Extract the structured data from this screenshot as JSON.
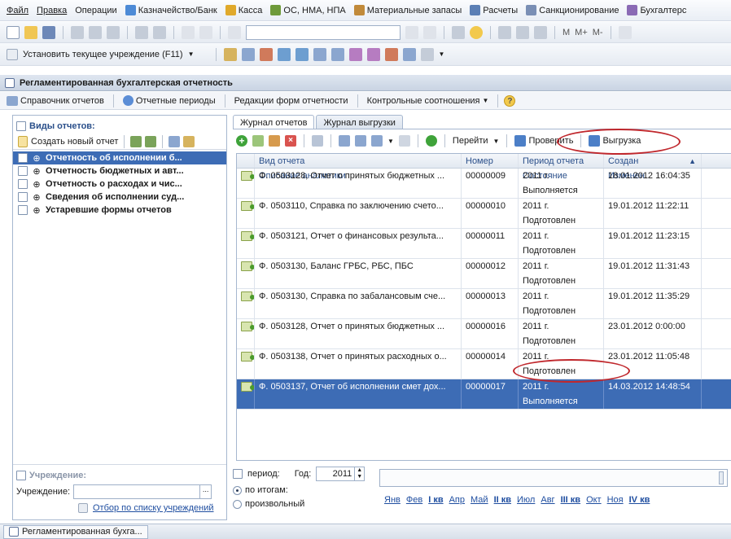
{
  "menubar": {
    "items": [
      {
        "label": "Файл",
        "icon": "none"
      },
      {
        "label": "Правка",
        "icon": "none"
      },
      {
        "label": "Операции",
        "icon": "none"
      },
      {
        "label": "Казначейство/Банк",
        "icon": "treasury-icon"
      },
      {
        "label": "Касса",
        "icon": "cashbox-icon"
      },
      {
        "label": "ОС, НМА, НПА",
        "icon": "assets-icon"
      },
      {
        "label": "Материальные запасы",
        "icon": "inventory-icon"
      },
      {
        "label": "Расчеты",
        "icon": "settlements-icon"
      },
      {
        "label": "Санкционирование",
        "icon": "authorization-icon"
      },
      {
        "label": "Бухгалтерс",
        "icon": "accounting-icon"
      }
    ]
  },
  "toolbar2": {
    "memory_buttons": [
      "M",
      "M+",
      "M-"
    ]
  },
  "toolbar3": {
    "set_institution_label": "Установить текущее учреждение (F11)"
  },
  "window": {
    "title": "Регламентированная бухгалтерская отчетность"
  },
  "cmdbar": {
    "items": [
      "Справочник отчетов",
      "Отчетные периоды",
      "Редакции форм отчетности",
      "Контрольные соотношения"
    ]
  },
  "left": {
    "group_label": "Виды отчетов:",
    "create_label": "Создать новый отчет",
    "tree": [
      "Отчетность об исполнении б...",
      "Отчетность бюджетных и авт...",
      "Отчетность о расходах и чис...",
      "Сведения об исполнении суд...",
      "Устаревшие формы отчетов"
    ],
    "institution_group": "Учреждение:",
    "institution_label": "Учреждение:",
    "institution_value": "",
    "filter_link": "Отбор по списку учреждений"
  },
  "tabs": [
    "Журнал отчетов",
    "Журнал выгрузки"
  ],
  "grid_toolbar": {
    "goto": "Перейти",
    "check": "Проверить",
    "export": "Выгрузка"
  },
  "grid": {
    "headers_top": [
      "Вид отчета",
      "Номер",
      "Период отчета",
      "Создан"
    ],
    "headers_bottom": [
      "Описание аналитики",
      "",
      "Состояние",
      "Изменен"
    ],
    "rows": [
      {
        "type": "Ф. 0503128, Отчет о принятых бюджетных ...",
        "number": "00000009",
        "period": "2011 г.",
        "state": "Выполняется",
        "created": "18.01.2012 16:04:35",
        "changed": ""
      },
      {
        "type": "Ф. 0503110, Справка по заключению счето...",
        "number": "00000010",
        "period": "2011 г.",
        "state": "Подготовлен",
        "created": "19.01.2012 11:22:11",
        "changed": ""
      },
      {
        "type": "Ф. 0503121, Отчет о финансовых результа...",
        "number": "00000011",
        "period": "2011 г.",
        "state": "Подготовлен",
        "created": "19.01.2012 11:23:15",
        "changed": ""
      },
      {
        "type": "Ф. 0503130, Баланс ГРБС, РБС, ПБС",
        "number": "00000012",
        "period": "2011 г.",
        "state": "Подготовлен",
        "created": "19.01.2012 11:31:43",
        "changed": ""
      },
      {
        "type": "Ф. 0503130, Справка по забалансовым сче...",
        "number": "00000013",
        "period": "2011 г.",
        "state": "Подготовлен",
        "created": "19.01.2012 11:35:29",
        "changed": ""
      },
      {
        "type": "Ф. 0503128, Отчет о принятых бюджетных ...",
        "number": "00000016",
        "period": "2011 г.",
        "state": "Подготовлен",
        "created": "23.01.2012 0:00:00",
        "changed": ""
      },
      {
        "type": "Ф. 0503138, Отчет о принятых расходных о...",
        "number": "00000014",
        "period": "2011 г.",
        "state": "Подготовлен",
        "created": "23.01.2012 11:05:48",
        "changed": ""
      },
      {
        "type": "Ф. 0503137, Отчет об исполнении смет дох...",
        "number": "00000017",
        "period": "2011 г.",
        "state": "Выполняется",
        "created": "14.03.2012 14:48:54",
        "changed": ""
      }
    ]
  },
  "period_panel": {
    "period_label": "период:",
    "year_label": "Год:",
    "year_value": "2011",
    "option_totals": "по итогам:",
    "option_custom": "произвольный",
    "months": [
      "Янв",
      "Фев",
      "I кв",
      "Апр",
      "Май",
      "II кв",
      "Июл",
      "Авг",
      "III кв",
      "Окт",
      "Ноя",
      "IV кв"
    ]
  },
  "taskbar": {
    "window_label": "Регламентированная бухга..."
  },
  "colors": {
    "selection": "#3d6cb5",
    "annotation": "#c0282d",
    "link": "#1f4ea0"
  }
}
